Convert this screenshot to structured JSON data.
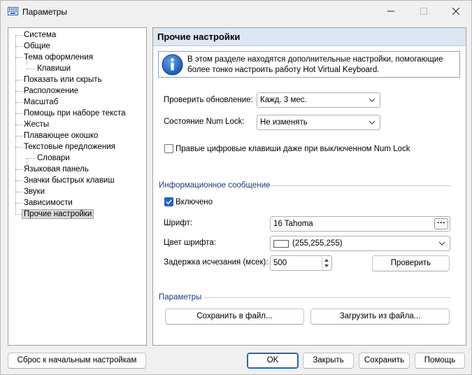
{
  "window": {
    "title": "Параметры"
  },
  "tree": {
    "items": [
      {
        "label": "Система"
      },
      {
        "label": "Общие"
      },
      {
        "label": "Тема оформления"
      },
      {
        "label": "Клавиши"
      },
      {
        "label": "Показать или скрыть"
      },
      {
        "label": "Расположение"
      },
      {
        "label": "Масштаб"
      },
      {
        "label": "Помощь при наборе текста"
      },
      {
        "label": "Жесты"
      },
      {
        "label": "Плавающее окошко"
      },
      {
        "label": "Текстовые предложения"
      },
      {
        "label": "Словари"
      },
      {
        "label": "Языковая панель"
      },
      {
        "label": "Значки быстрых клавиш"
      },
      {
        "label": "Звуки"
      },
      {
        "label": "Зависимости"
      },
      {
        "label": "Прочие настройки"
      }
    ],
    "selected": "Прочие настройки"
  },
  "panel": {
    "title": "Прочие настройки",
    "info_text": "В этом разделе находятся дополнительные настройки, помогающие более тонко настроить работу Hot Virtual Keyboard.",
    "check_update_label": "Проверить обновление:",
    "check_update_value": "Кажд. 3 мес.",
    "numlock_label": "Состояние Num Lock:",
    "numlock_value": "Не изменять",
    "right_digit_keys_label": "Правые цифровые клавиши даже при выключенном Num Lock",
    "right_digit_keys_checked": false,
    "info_message_group": "Информационное сообщение",
    "enabled_label": "Включено",
    "enabled_checked": true,
    "font_label": "Шрифт:",
    "font_value": "16 Tahoma",
    "font_browse": "···",
    "font_color_label": "Цвет шрифта:",
    "font_color_value": "(255,255,255)",
    "fade_delay_label": "Задержка исчезания (мсек):",
    "fade_delay_value": "500",
    "check_button": "Проверить",
    "params_group": "Параметры",
    "save_to_file": "Сохранить в файл...",
    "load_from_file": "Загрузить из файла..."
  },
  "footer": {
    "reset": "Сброс к начальным настройкам",
    "ok": "OK",
    "close": "Закрыть",
    "save": "Сохранить",
    "help": "Помощь"
  },
  "colors": {
    "accent": "#1f65c8",
    "header_bg": "#dde7f4",
    "group_title": "#1a3d7a"
  }
}
